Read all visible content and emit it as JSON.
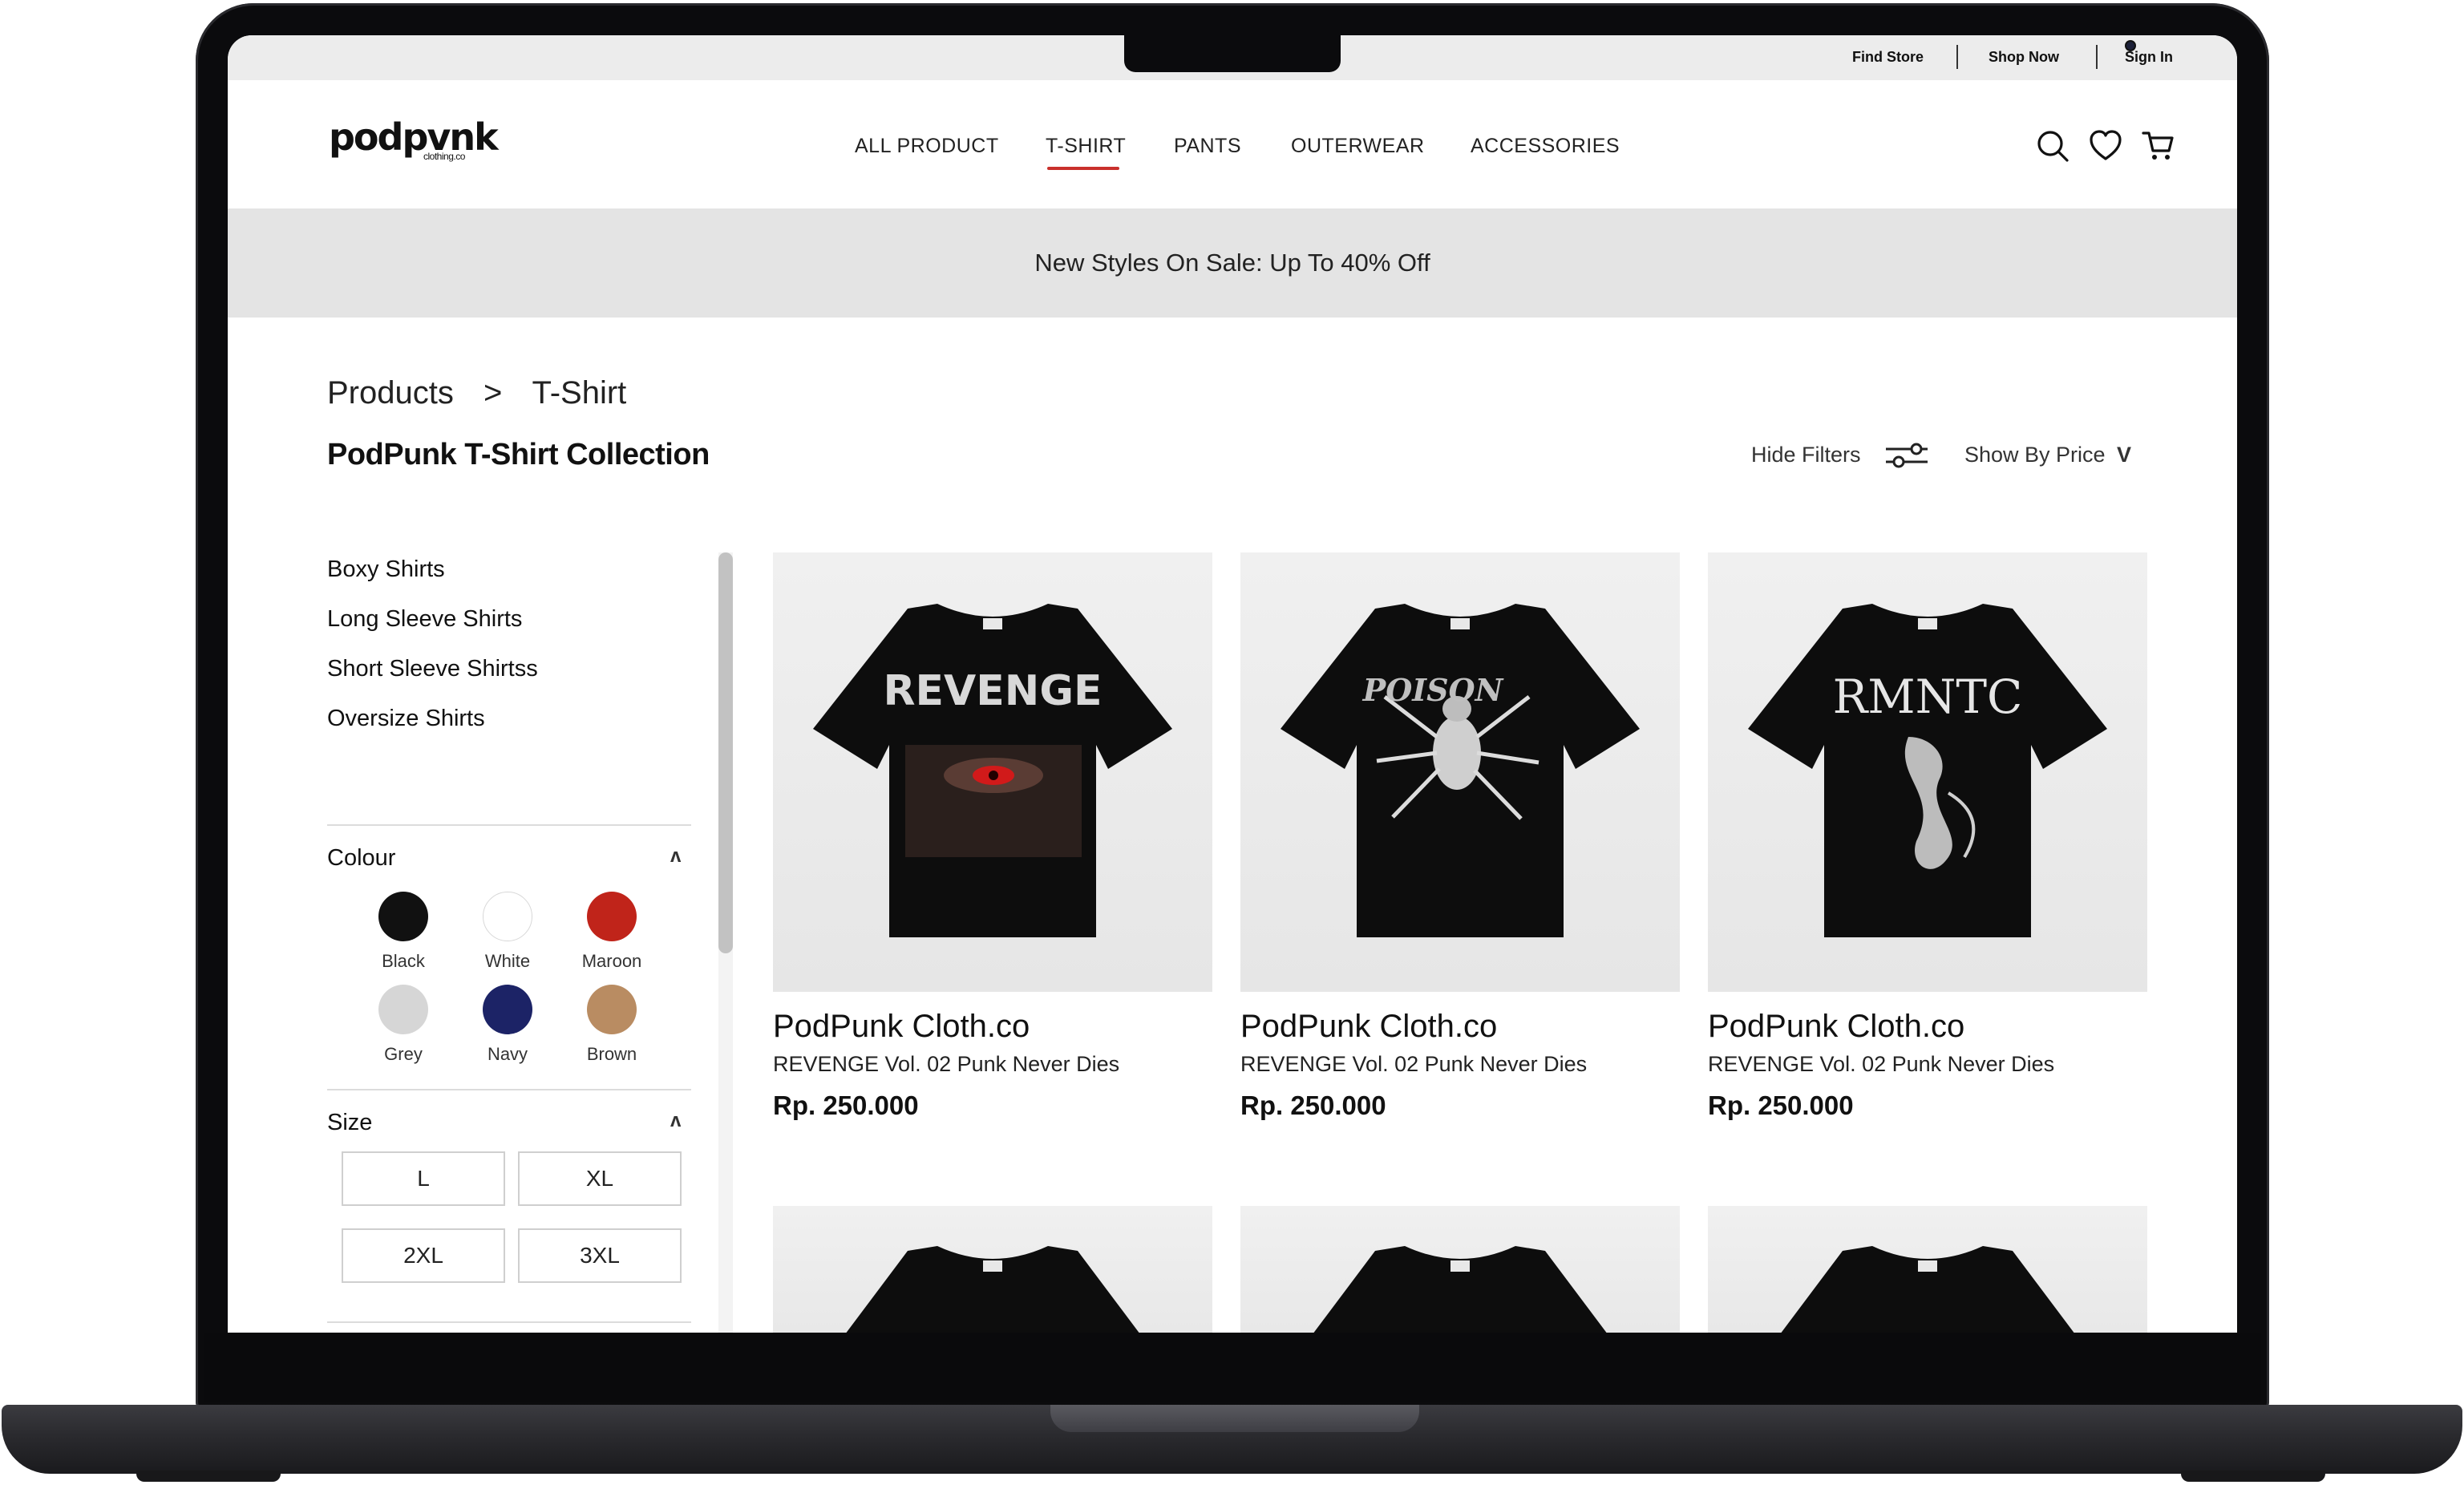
{
  "topbar": {
    "find_store": "Find Store",
    "shop_now": "Shop Now",
    "sign_in": "Sign In"
  },
  "header": {
    "logo_main": "podpvnk",
    "logo_sub": "clothing.co",
    "nav": [
      "ALL PRODUCT",
      "T-SHIRT",
      "PANTS",
      "OUTERWEAR",
      "ACCESSORIES"
    ],
    "active_nav": "T-SHIRT",
    "icons": [
      "search-icon",
      "heart-icon",
      "cart-icon"
    ]
  },
  "promo": {
    "text": "New Styles On Sale: Up To 40% Off"
  },
  "breadcrumb": {
    "root": "Products",
    "separator": ">",
    "current": "T-Shirt"
  },
  "page": {
    "title": "PodPunk T-Shirt Collection",
    "hide_filters": "Hide Filters",
    "sort_label": "Show By Price",
    "sort_caret": "V"
  },
  "sidebar": {
    "categories": [
      "Boxy Shirts",
      "Long Sleeve Shirts",
      "Short Sleeve Shirtss",
      "Oversize Shirts"
    ],
    "colour": {
      "title": "Colour",
      "caret": "ʌ",
      "swatches": [
        {
          "name": "Black",
          "hex": "#111111"
        },
        {
          "name": "White",
          "hex": "#ffffff"
        },
        {
          "name": "Maroon",
          "hex": "#c0241a"
        },
        {
          "name": "Grey",
          "hex": "#d6d6d6"
        },
        {
          "name": "Navy",
          "hex": "#1c2366"
        },
        {
          "name": "Brown",
          "hex": "#b98c62"
        }
      ]
    },
    "size": {
      "title": "Size",
      "caret": "ʌ",
      "options": [
        "L",
        "XL",
        "2XL",
        "3XL"
      ]
    }
  },
  "products": [
    {
      "brand": "PodPunk Cloth.co",
      "name": "REVENGE Vol. 02 Punk Never Dies",
      "price": "Rp. 250.000",
      "graphic_text": "REVENGE"
    },
    {
      "brand": "PodPunk Cloth.co",
      "name": "REVENGE Vol. 02 Punk Never Dies",
      "price": "Rp. 250.000",
      "graphic_text": "POISON"
    },
    {
      "brand": "PodPunk Cloth.co",
      "name": "REVENGE Vol. 02 Punk Never Dies",
      "price": "Rp. 250.000",
      "graphic_text": "RMNTC"
    }
  ],
  "colors": {
    "accent": "#c9302c",
    "promo_bg": "#e4e4e4",
    "topbar_bg": "#ececec"
  }
}
